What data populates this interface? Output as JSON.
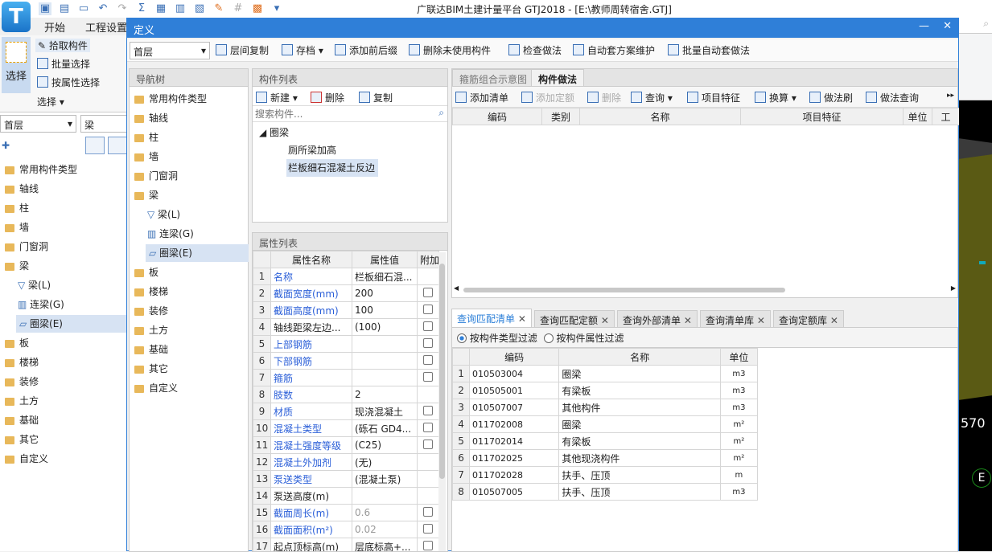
{
  "app": {
    "title": "广联达BIM土建计量平台 GTJ2018 - [E:\\教师周转宿舍.GTJ]",
    "logo": "T",
    "menu": [
      "开始",
      "工程设置"
    ]
  },
  "ribbon": {
    "select_big": "选择",
    "pick": "拾取构件",
    "batch": "批量选择",
    "by_attr": "按属性选择",
    "group": "选择"
  },
  "left": {
    "floor": "首层",
    "type": "梁",
    "tree": [
      "常用构件类型",
      "轴线",
      "柱",
      "墙",
      "门窗洞",
      "梁",
      "梁(L)",
      "连梁(G)",
      "圈梁(E)",
      "板",
      "楼梯",
      "装修",
      "土方",
      "基础",
      "其它",
      "自定义"
    ]
  },
  "dialog": {
    "title": "定义",
    "floor": "首层",
    "toolbar": [
      "层间复制",
      "存档",
      "添加前后缀",
      "删除未使用构件",
      "检查做法",
      "自动套方案维护",
      "批量自动套做法"
    ]
  },
  "nav": {
    "header": "导航树",
    "items": [
      "常用构件类型",
      "轴线",
      "柱",
      "墙",
      "门窗洞",
      "梁",
      "梁(L)",
      "连梁(G)",
      "圈梁(E)",
      "板",
      "楼梯",
      "装修",
      "土方",
      "基础",
      "其它",
      "自定义"
    ]
  },
  "complist": {
    "header": "构件列表",
    "new": "新建",
    "delete": "删除",
    "copy": "复制",
    "search_placeholder": "搜索构件...",
    "group": "圈梁",
    "items": [
      "厕所梁加高",
      "栏板细石混凝土反边"
    ]
  },
  "props": {
    "header": "属性列表",
    "cols": [
      "属性名称",
      "属性值",
      "附加"
    ],
    "rows": [
      {
        "n": "1",
        "name": "名称",
        "val": "栏板细石混...",
        "blue": true,
        "cb": false,
        "gray": false
      },
      {
        "n": "2",
        "name": "截面宽度(mm)",
        "val": "200",
        "blue": true,
        "cb": true,
        "gray": false
      },
      {
        "n": "3",
        "name": "截面高度(mm)",
        "val": "100",
        "blue": true,
        "cb": true,
        "gray": false
      },
      {
        "n": "4",
        "name": "轴线距梁左边...",
        "val": "(100)",
        "blue": false,
        "cb": true,
        "gray": false
      },
      {
        "n": "5",
        "name": "上部钢筋",
        "val": "",
        "blue": true,
        "cb": true,
        "gray": false
      },
      {
        "n": "6",
        "name": "下部钢筋",
        "val": "",
        "blue": true,
        "cb": true,
        "gray": false
      },
      {
        "n": "7",
        "name": "箍筋",
        "val": "",
        "blue": true,
        "cb": true,
        "gray": false
      },
      {
        "n": "8",
        "name": "肢数",
        "val": "2",
        "blue": true,
        "cb": false,
        "gray": false
      },
      {
        "n": "9",
        "name": "材质",
        "val": "现浇混凝土",
        "blue": true,
        "cb": true,
        "gray": false
      },
      {
        "n": "10",
        "name": "混凝土类型",
        "val": "(砾石 GD4...",
        "blue": true,
        "cb": true,
        "gray": false
      },
      {
        "n": "11",
        "name": "混凝土强度等级",
        "val": "(C25)",
        "blue": true,
        "cb": true,
        "gray": false
      },
      {
        "n": "12",
        "name": "混凝土外加剂",
        "val": "(无)",
        "blue": true,
        "cb": false,
        "gray": false
      },
      {
        "n": "13",
        "name": "泵送类型",
        "val": "(混凝土泵)",
        "blue": true,
        "cb": false,
        "gray": false
      },
      {
        "n": "14",
        "name": "泵送高度(m)",
        "val": "",
        "blue": false,
        "cb": false,
        "gray": false
      },
      {
        "n": "15",
        "name": "截面周长(m)",
        "val": "0.6",
        "blue": true,
        "cb": true,
        "gray": true
      },
      {
        "n": "16",
        "name": "截面面积(m²)",
        "val": "0.02",
        "blue": true,
        "cb": true,
        "gray": true
      },
      {
        "n": "17",
        "name": "起点顶标高(m)",
        "val": "层底标高+...",
        "blue": false,
        "cb": true,
        "gray": false
      }
    ]
  },
  "method": {
    "tabs": [
      "箍筋组合示意图",
      "构件做法"
    ],
    "toolbar": [
      "添加清单",
      "添加定额",
      "删除",
      "查询",
      "项目特征",
      "换算",
      "做法刷",
      "做法查询"
    ],
    "cols": [
      "编码",
      "类别",
      "名称",
      "项目特征",
      "单位",
      "工"
    ]
  },
  "query": {
    "tabs": [
      "查询匹配清单",
      "查询匹配定额",
      "查询外部清单",
      "查询清单库",
      "查询定额库"
    ],
    "filter1": "按构件类型过滤",
    "filter2": "按构件属性过滤",
    "cols": [
      "编码",
      "名称",
      "单位"
    ],
    "rows": [
      [
        "1",
        "010503004",
        "圈梁",
        "m3"
      ],
      [
        "2",
        "010505001",
        "有梁板",
        "m3"
      ],
      [
        "3",
        "010507007",
        "其他构件",
        "m3"
      ],
      [
        "4",
        "011702008",
        "圈梁",
        "m²"
      ],
      [
        "5",
        "011702014",
        "有梁板",
        "m²"
      ],
      [
        "6",
        "011702025",
        "其他现浇构件",
        "m²"
      ],
      [
        "7",
        "011702028",
        "扶手、压顶",
        "m"
      ],
      [
        "8",
        "010507005",
        "扶手、压顶",
        "m3"
      ]
    ]
  },
  "view": {
    "label": "570",
    "axis": "E"
  },
  "colors": {
    "accent": "#2f7fd8",
    "link": "#2b5fd8",
    "olive": "#5a5a14"
  }
}
